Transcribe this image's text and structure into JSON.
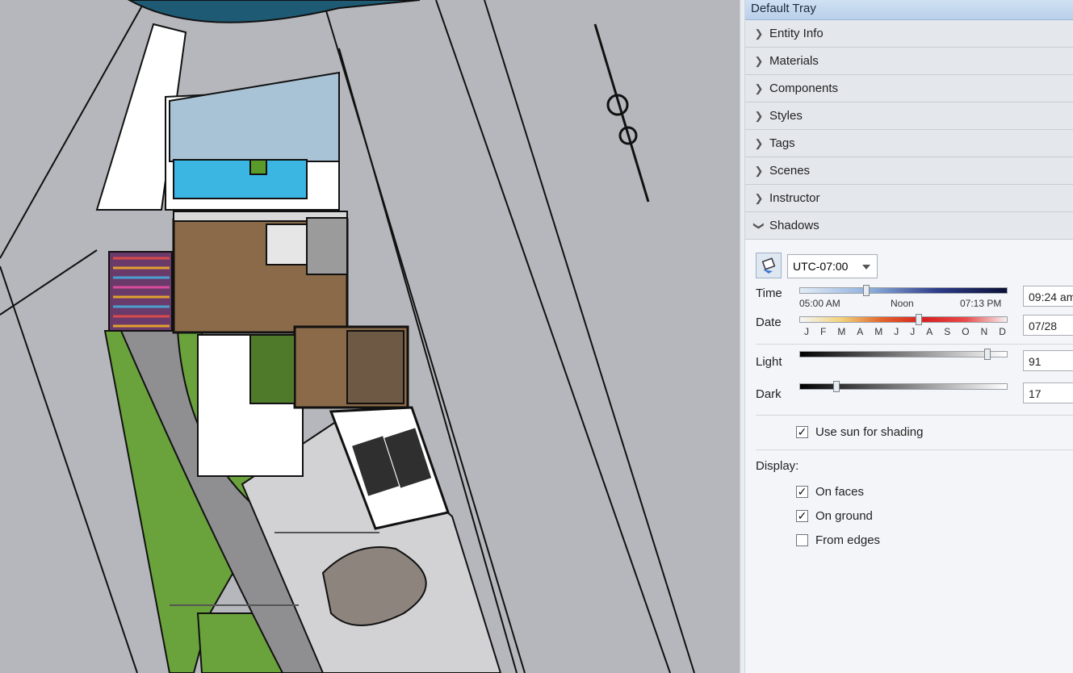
{
  "tray": {
    "title": "Default Tray",
    "panels": [
      {
        "label": "Entity Info",
        "expanded": false
      },
      {
        "label": "Materials",
        "expanded": false
      },
      {
        "label": "Components",
        "expanded": false
      },
      {
        "label": "Styles",
        "expanded": false
      },
      {
        "label": "Tags",
        "expanded": false
      },
      {
        "label": "Scenes",
        "expanded": false
      },
      {
        "label": "Instructor",
        "expanded": false
      },
      {
        "label": "Shadows",
        "expanded": true
      }
    ]
  },
  "shadows": {
    "timezone": "UTC-07:00",
    "time_label": "Time",
    "time_start": "05:00 AM",
    "time_noon": "Noon",
    "time_end": "07:13 PM",
    "time_value": "09:24 am",
    "time_position": 0.31,
    "date_label": "Date",
    "months": [
      "J",
      "F",
      "M",
      "A",
      "M",
      "J",
      "J",
      "A",
      "S",
      "O",
      "N",
      "D"
    ],
    "date_value": "07/28",
    "date_position": 0.57,
    "light_label": "Light",
    "light_value": "91",
    "dark_label": "Dark",
    "dark_value": "17",
    "use_sun_label": "Use sun for shading",
    "use_sun_checked": true,
    "display_label": "Display:",
    "on_faces_label": "On faces",
    "on_faces_checked": true,
    "on_ground_label": "On ground",
    "on_ground_checked": true,
    "from_edges_label": "From edges",
    "from_edges_checked": false
  },
  "colors": {
    "ground": "#b6b7bc",
    "lawn": "#6aa23c",
    "pool": "#3bb6e3",
    "floor": "#8a6a48",
    "tray_header": "#c4d8ee"
  }
}
